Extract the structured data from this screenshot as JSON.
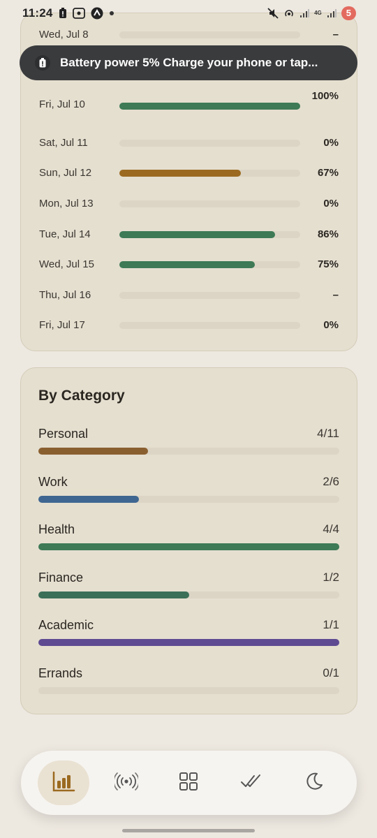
{
  "status_bar": {
    "time": "11:24",
    "battery_level": "5",
    "network": "4G"
  },
  "toast": {
    "text": "Battery power 5%  Charge your phone or tap..."
  },
  "days": [
    {
      "label": "Wed, Jul 8",
      "value": null,
      "pct_text": "–",
      "color": ""
    },
    {
      "label": "Fri, Jul 10",
      "value": 1.0,
      "pct_text": "100%",
      "color": "#3d7a55"
    },
    {
      "label": "Sat, Jul 11",
      "value": 0,
      "pct_text": "0%",
      "color": ""
    },
    {
      "label": "Sun, Jul 12",
      "value": 0.67,
      "pct_text": "67%",
      "color": "#9b6a20"
    },
    {
      "label": "Mon, Jul 13",
      "value": 0,
      "pct_text": "0%",
      "color": ""
    },
    {
      "label": "Tue, Jul 14",
      "value": 0.86,
      "pct_text": "86%",
      "color": "#3d7a55"
    },
    {
      "label": "Wed, Jul 15",
      "value": 0.75,
      "pct_text": "75%",
      "color": "#3d7a55"
    },
    {
      "label": "Thu, Jul 16",
      "value": null,
      "pct_text": "–",
      "color": ""
    },
    {
      "label": "Fri, Jul 17",
      "value": 0,
      "pct_text": "0%",
      "color": ""
    }
  ],
  "by_category": {
    "title": "By Category",
    "items": [
      {
        "name": "Personal",
        "count": "4/11",
        "value": 0.3636,
        "color": "#8a5f30"
      },
      {
        "name": "Work",
        "count": "2/6",
        "value": 0.3333,
        "color": "#3f6691"
      },
      {
        "name": "Health",
        "count": "4/4",
        "value": 1.0,
        "color": "#3d7a55"
      },
      {
        "name": "Finance",
        "count": "1/2",
        "value": 0.5,
        "color": "#3b6f58"
      },
      {
        "name": "Academic",
        "count": "1/1",
        "value": 1.0,
        "color": "#5d4a91"
      },
      {
        "name": "Errands",
        "count": "0/1",
        "value": 0,
        "color": ""
      }
    ]
  },
  "bottom_nav": {
    "items": [
      {
        "name": "stats",
        "icon": "bar-chart-icon",
        "active": true
      },
      {
        "name": "focus",
        "icon": "broadcast-icon",
        "active": false
      },
      {
        "name": "dashboard",
        "icon": "grid-icon",
        "active": false
      },
      {
        "name": "tasks",
        "icon": "double-check-icon",
        "active": false
      },
      {
        "name": "sleep",
        "icon": "moon-icon",
        "active": false
      }
    ]
  }
}
